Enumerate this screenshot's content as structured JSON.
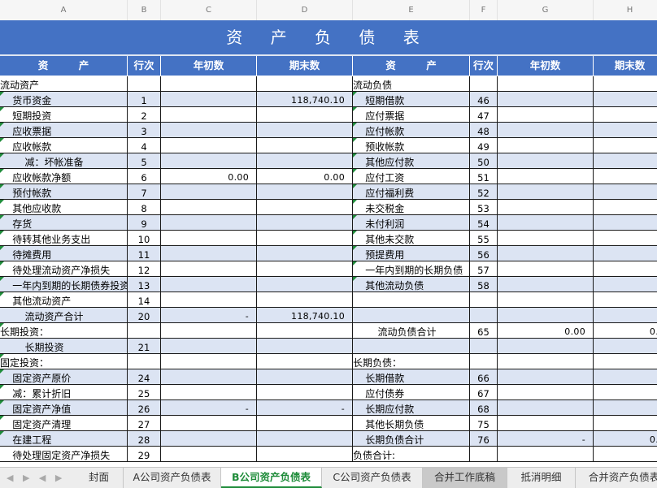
{
  "column_letters": [
    "A",
    "B",
    "C",
    "D",
    "E",
    "F",
    "G",
    "H"
  ],
  "title": "资 产 负 债 表",
  "headers": [
    "资　　　产",
    "行次",
    "年初数",
    "期末数",
    "资　　　产",
    "行次",
    "年初数",
    "期末数"
  ],
  "rows": [
    {
      "a": "流动资产",
      "b": "",
      "c": "",
      "d": "",
      "e": "流动负债",
      "f": "",
      "g": "",
      "h": ""
    },
    {
      "a": "  货币资金",
      "b": "1",
      "c": "",
      "d": "118,740.10",
      "e": "  短期借款",
      "f": "46",
      "g": "",
      "h": ""
    },
    {
      "a": "  短期投资",
      "b": "2",
      "c": "",
      "d": "",
      "e": "  应付票据",
      "f": "47",
      "g": "",
      "h": ""
    },
    {
      "a": "  应收票据",
      "b": "3",
      "c": "",
      "d": "",
      "e": "  应付帐款",
      "f": "48",
      "g": "",
      "h": ""
    },
    {
      "a": "  应收帐款",
      "b": "4",
      "c": "",
      "d": "",
      "e": "  预收帐款",
      "f": "49",
      "g": "",
      "h": ""
    },
    {
      "a": "    减：坏帐准备",
      "b": "5",
      "c": "",
      "d": "",
      "e": "  其他应付款",
      "f": "50",
      "g": "",
      "h": ""
    },
    {
      "a": "  应收帐款净额",
      "b": "6",
      "c": "0.00",
      "d": "0.00",
      "e": "  应付工资",
      "f": "51",
      "g": "",
      "h": ""
    },
    {
      "a": "  预付帐款",
      "b": "7",
      "c": "",
      "d": "",
      "e": "  应付福利费",
      "f": "52",
      "g": "",
      "h": ""
    },
    {
      "a": "  其他应收款",
      "b": "8",
      "c": "",
      "d": "",
      "e": "  未交税金",
      "f": "53",
      "g": "",
      "h": ""
    },
    {
      "a": "  存货",
      "b": "9",
      "c": "",
      "d": "",
      "e": "  未付利润",
      "f": "54",
      "g": "",
      "h": ""
    },
    {
      "a": "  待转其他业务支出",
      "b": "10",
      "c": "",
      "d": "",
      "e": "  其他未交款",
      "f": "55",
      "g": "",
      "h": ""
    },
    {
      "a": "  待摊费用",
      "b": "11",
      "c": "",
      "d": "",
      "e": "  预提费用",
      "f": "56",
      "g": "",
      "h": ""
    },
    {
      "a": "  待处理流动资产净损失",
      "b": "12",
      "c": "",
      "d": "",
      "e": "  一年内到期的长期负债",
      "f": "57",
      "g": "",
      "h": ""
    },
    {
      "a": "  一年内到期的长期债券投资",
      "b": "13",
      "c": "",
      "d": "",
      "e": "  其他流动负债",
      "f": "58",
      "g": "",
      "h": ""
    },
    {
      "a": "  其他流动资产",
      "b": "14",
      "c": "",
      "d": "",
      "e": "",
      "f": "",
      "g": "",
      "h": ""
    },
    {
      "a": "    流动资产合计",
      "b": "20",
      "c": "-",
      "d": "118,740.10",
      "e": "",
      "f": "",
      "g": "",
      "h": ""
    },
    {
      "a": "长期投资：",
      "b": "",
      "c": "",
      "d": "",
      "e": "    流动负债合计",
      "f": "65",
      "g": "0.00",
      "h": "0."
    },
    {
      "a": "    长期投资",
      "b": "21",
      "c": "",
      "d": "",
      "e": "",
      "f": "",
      "g": "",
      "h": ""
    },
    {
      "a": "固定投资：",
      "b": "",
      "c": "",
      "d": "",
      "e": "长期负债：",
      "f": "",
      "g": "",
      "h": ""
    },
    {
      "a": "  固定资产原价",
      "b": "24",
      "c": "",
      "d": "",
      "e": "  长期借款",
      "f": "66",
      "g": "",
      "h": ""
    },
    {
      "a": "  减：累计折旧",
      "b": "25",
      "c": "",
      "d": "",
      "e": "  应付债券",
      "f": "67",
      "g": "",
      "h": ""
    },
    {
      "a": "  固定资产净值",
      "b": "26",
      "c": "-",
      "d": "-",
      "e": "  长期应付款",
      "f": "68",
      "g": "",
      "h": ""
    },
    {
      "a": "  固定资产清理",
      "b": "27",
      "c": "",
      "d": "",
      "e": "  其他长期负债",
      "f": "75",
      "g": "",
      "h": ""
    },
    {
      "a": "  在建工程",
      "b": "28",
      "c": "",
      "d": "",
      "e": "  长期负债合计",
      "f": "76",
      "g": "-",
      "h": "0."
    },
    {
      "a": "  待处理固定资产净损失",
      "b": "29",
      "c": "",
      "d": "",
      "e": "负债合计:",
      "f": "",
      "g": "",
      "h": ""
    }
  ],
  "sheet_tabs": [
    {
      "label": "封面",
      "active": false,
      "gray": false
    },
    {
      "label": "A公司资产负债表",
      "active": false,
      "gray": false
    },
    {
      "label": "B公司资产负债表",
      "active": true,
      "gray": false
    },
    {
      "label": "C公司资产负债表",
      "active": false,
      "gray": false
    },
    {
      "label": "合并工作底稿",
      "active": false,
      "gray": true
    },
    {
      "label": "抵消明细",
      "active": false,
      "gray": false
    },
    {
      "label": "合并资产负债表",
      "active": false,
      "gray": false
    }
  ],
  "colors": {
    "header_blue": "#4472c4",
    "stripe": "#dce4f3",
    "active_tab": "#1f8c3a"
  }
}
